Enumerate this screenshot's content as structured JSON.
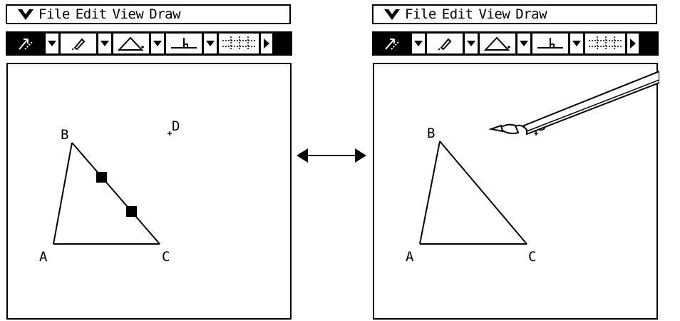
{
  "menu": {
    "items": [
      "File",
      "Edit",
      "View",
      "Draw"
    ]
  },
  "toolbar": {
    "tools": [
      "select-arrow",
      "draw-pen",
      "triangle",
      "perpendicular",
      "grid"
    ]
  },
  "geometry": {
    "point_labels": {
      "A": "A",
      "B": "B",
      "C": "C",
      "D": "D"
    }
  },
  "icons": {
    "menu": "chevron-down-icon",
    "transition": "double-arrow-icon",
    "stylus": "stylus-pen-icon"
  }
}
